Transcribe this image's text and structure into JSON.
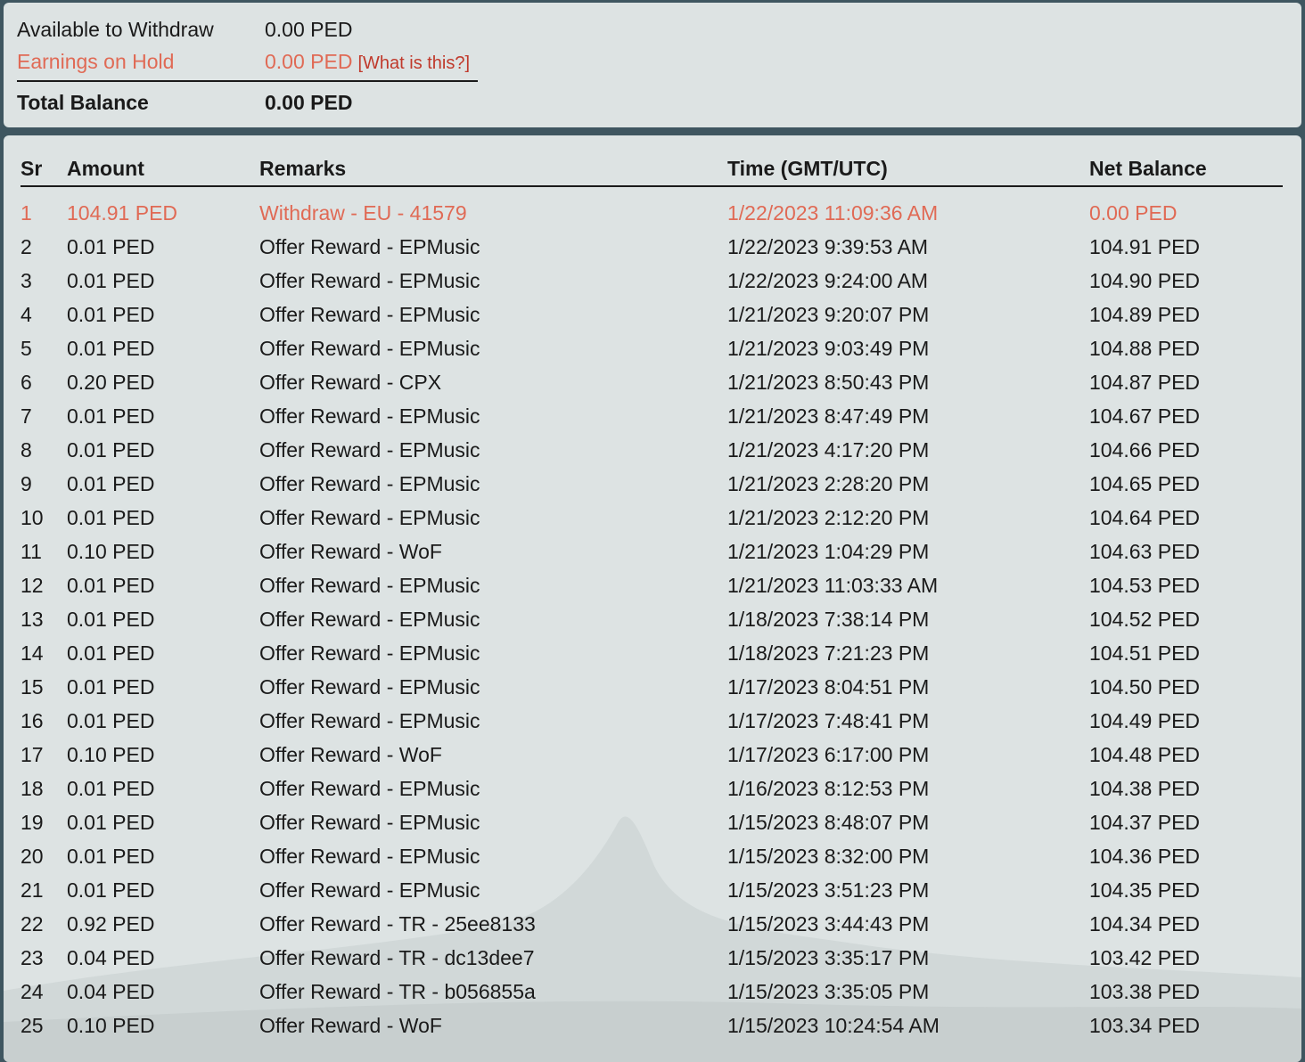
{
  "summary": {
    "available_label": "Available to Withdraw",
    "available_value": "0.00 PED",
    "hold_label": "Earnings on Hold",
    "hold_value": "0.00 PED",
    "hold_hint": "[What is this?]",
    "total_label": "Total Balance",
    "total_value": "0.00 PED"
  },
  "colors": {
    "accent": "#e06a55",
    "panel": "#dde3e3",
    "frame": "#3f5660"
  },
  "table": {
    "columns": [
      "Sr",
      "Amount",
      "Remarks",
      "Time (GMT/UTC)",
      "Net Balance"
    ],
    "rows": [
      {
        "sr": "1",
        "amount": "104.91 PED",
        "remarks": "Withdraw - EU - 41579",
        "time": "1/22/2023 11:09:36 AM",
        "net": "0.00 PED",
        "type": "withdraw"
      },
      {
        "sr": "2",
        "amount": "0.01 PED",
        "remarks": "Offer Reward - EPMusic",
        "time": "1/22/2023 9:39:53 AM",
        "net": "104.91 PED",
        "type": "reward"
      },
      {
        "sr": "3",
        "amount": "0.01 PED",
        "remarks": "Offer Reward - EPMusic",
        "time": "1/22/2023 9:24:00 AM",
        "net": "104.90 PED",
        "type": "reward"
      },
      {
        "sr": "4",
        "amount": "0.01 PED",
        "remarks": "Offer Reward - EPMusic",
        "time": "1/21/2023 9:20:07 PM",
        "net": "104.89 PED",
        "type": "reward"
      },
      {
        "sr": "5",
        "amount": "0.01 PED",
        "remarks": "Offer Reward - EPMusic",
        "time": "1/21/2023 9:03:49 PM",
        "net": "104.88 PED",
        "type": "reward"
      },
      {
        "sr": "6",
        "amount": "0.20 PED",
        "remarks": "Offer Reward - CPX",
        "time": "1/21/2023 8:50:43 PM",
        "net": "104.87 PED",
        "type": "reward"
      },
      {
        "sr": "7",
        "amount": "0.01 PED",
        "remarks": "Offer Reward - EPMusic",
        "time": "1/21/2023 8:47:49 PM",
        "net": "104.67 PED",
        "type": "reward"
      },
      {
        "sr": "8",
        "amount": "0.01 PED",
        "remarks": "Offer Reward - EPMusic",
        "time": "1/21/2023 4:17:20 PM",
        "net": "104.66 PED",
        "type": "reward"
      },
      {
        "sr": "9",
        "amount": "0.01 PED",
        "remarks": "Offer Reward - EPMusic",
        "time": "1/21/2023 2:28:20 PM",
        "net": "104.65 PED",
        "type": "reward"
      },
      {
        "sr": "10",
        "amount": "0.01 PED",
        "remarks": "Offer Reward - EPMusic",
        "time": "1/21/2023 2:12:20 PM",
        "net": "104.64 PED",
        "type": "reward"
      },
      {
        "sr": "11",
        "amount": "0.10 PED",
        "remarks": "Offer Reward - WoF",
        "time": "1/21/2023 1:04:29 PM",
        "net": "104.63 PED",
        "type": "reward"
      },
      {
        "sr": "12",
        "amount": "0.01 PED",
        "remarks": "Offer Reward - EPMusic",
        "time": "1/21/2023 11:03:33 AM",
        "net": "104.53 PED",
        "type": "reward"
      },
      {
        "sr": "13",
        "amount": "0.01 PED",
        "remarks": "Offer Reward - EPMusic",
        "time": "1/18/2023 7:38:14 PM",
        "net": "104.52 PED",
        "type": "reward"
      },
      {
        "sr": "14",
        "amount": "0.01 PED",
        "remarks": "Offer Reward - EPMusic",
        "time": "1/18/2023 7:21:23 PM",
        "net": "104.51 PED",
        "type": "reward"
      },
      {
        "sr": "15",
        "amount": "0.01 PED",
        "remarks": "Offer Reward - EPMusic",
        "time": "1/17/2023 8:04:51 PM",
        "net": "104.50 PED",
        "type": "reward"
      },
      {
        "sr": "16",
        "amount": "0.01 PED",
        "remarks": "Offer Reward - EPMusic",
        "time": "1/17/2023 7:48:41 PM",
        "net": "104.49 PED",
        "type": "reward"
      },
      {
        "sr": "17",
        "amount": "0.10 PED",
        "remarks": "Offer Reward - WoF",
        "time": "1/17/2023 6:17:00 PM",
        "net": "104.48 PED",
        "type": "reward"
      },
      {
        "sr": "18",
        "amount": "0.01 PED",
        "remarks": "Offer Reward - EPMusic",
        "time": "1/16/2023 8:12:53 PM",
        "net": "104.38 PED",
        "type": "reward"
      },
      {
        "sr": "19",
        "amount": "0.01 PED",
        "remarks": "Offer Reward - EPMusic",
        "time": "1/15/2023 8:48:07 PM",
        "net": "104.37 PED",
        "type": "reward"
      },
      {
        "sr": "20",
        "amount": "0.01 PED",
        "remarks": "Offer Reward - EPMusic",
        "time": "1/15/2023 8:32:00 PM",
        "net": "104.36 PED",
        "type": "reward"
      },
      {
        "sr": "21",
        "amount": "0.01 PED",
        "remarks": "Offer Reward - EPMusic",
        "time": "1/15/2023 3:51:23 PM",
        "net": "104.35 PED",
        "type": "reward"
      },
      {
        "sr": "22",
        "amount": "0.92 PED",
        "remarks": "Offer Reward - TR - 25ee8133",
        "time": "1/15/2023 3:44:43 PM",
        "net": "104.34 PED",
        "type": "reward"
      },
      {
        "sr": "23",
        "amount": "0.04 PED",
        "remarks": "Offer Reward - TR - dc13dee7",
        "time": "1/15/2023 3:35:17 PM",
        "net": "103.42 PED",
        "type": "reward"
      },
      {
        "sr": "24",
        "amount": "0.04 PED",
        "remarks": "Offer Reward - TR - b056855a",
        "time": "1/15/2023 3:35:05 PM",
        "net": "103.38 PED",
        "type": "reward"
      },
      {
        "sr": "25",
        "amount": "0.10 PED",
        "remarks": "Offer Reward - WoF",
        "time": "1/15/2023 10:24:54 AM",
        "net": "103.34 PED",
        "type": "reward"
      }
    ]
  }
}
